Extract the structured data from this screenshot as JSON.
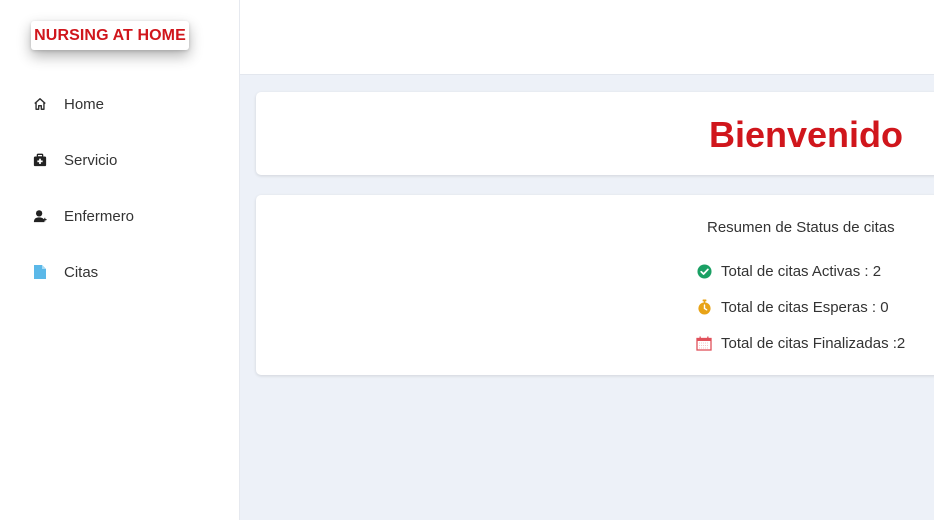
{
  "brand": {
    "name": "NURSING AT HOME",
    "color": "#d0161c"
  },
  "sidebar": {
    "items": [
      {
        "label": "Home",
        "icon": "home-icon"
      },
      {
        "label": "Servicio",
        "icon": "medkit-icon"
      },
      {
        "label": "Enfermero",
        "icon": "nurse-icon"
      },
      {
        "label": "Citas",
        "icon": "document-icon"
      }
    ]
  },
  "welcome": {
    "title": "Bienvenido"
  },
  "summary": {
    "title": "Resumen de Status de citas",
    "stats": [
      {
        "text": "Total de citas Activas : 2",
        "icon": "check-circle-icon",
        "color": "#1aa064"
      },
      {
        "text": "Total de citas Esperas : 0",
        "icon": "stopwatch-icon",
        "color": "#e8a317"
      },
      {
        "text": "Total de citas Finalizadas :2",
        "icon": "calendar-icon",
        "color": "#e0505a"
      }
    ]
  },
  "colors": {
    "accent": "#d0161c",
    "background": "#edf1f8"
  }
}
